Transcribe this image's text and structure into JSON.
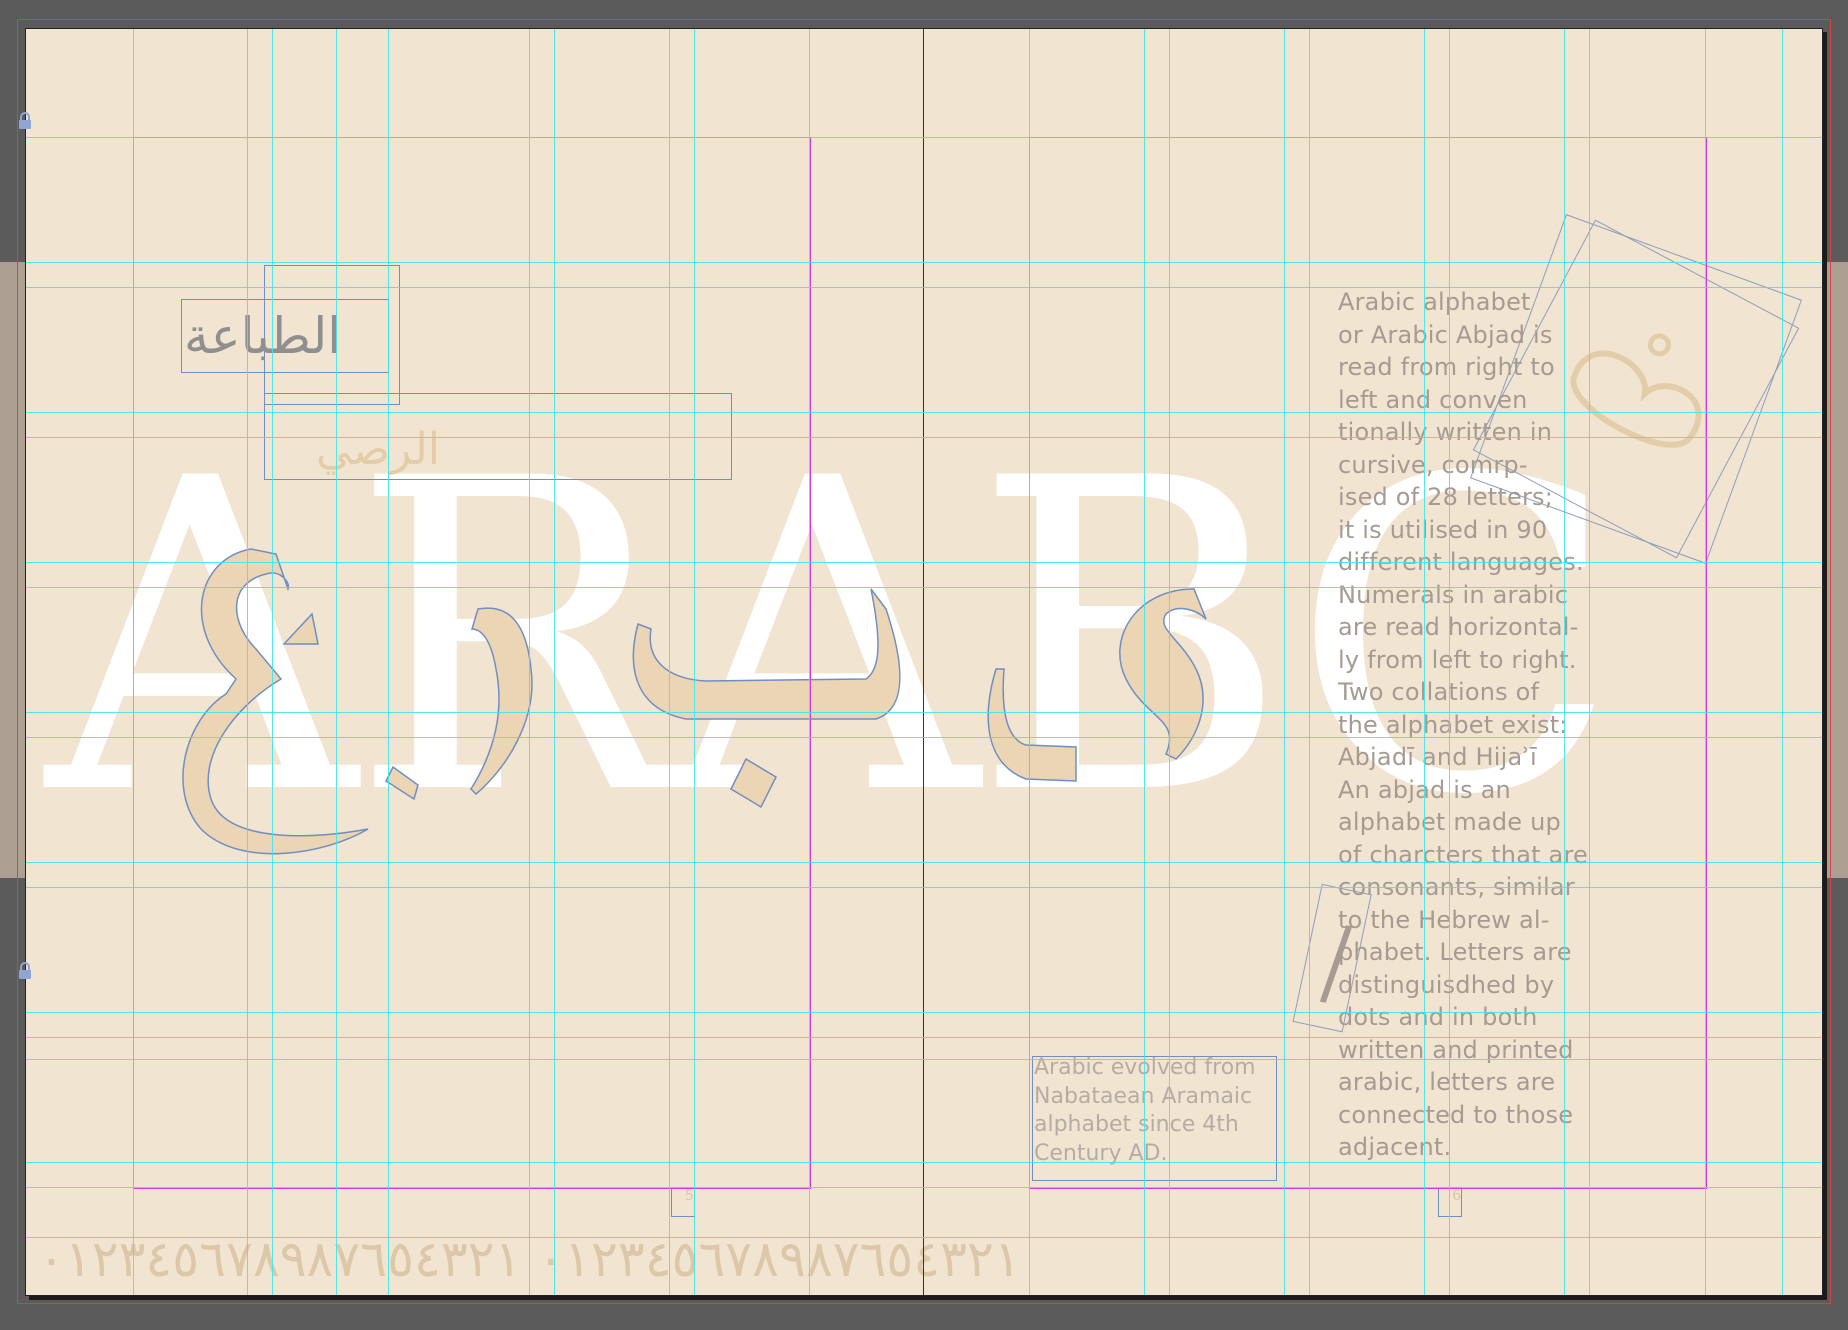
{
  "document": {
    "title_word": "ARABC",
    "arabic_heading": "الطباعة",
    "arabic_subheading": "الرصي",
    "body_text": "Arabic alphabet\nor Arabic Abjad is\nread from right to\nleft and conven\ntionally written in\ncursive, comrp-\nised of 28 letters;\nit is utilised in 90\ndifferent languages.\nNumerals in arabic\nare read horizontal-\nly from left to right.\nTwo collations of\nthe alphabet exist:\nAbjadī and Hijaʾī\nAn abjad is an\nalphabet made up\nof charcters that are\nconsonants, similar\nto the Hebrew al-\nphabet. Letters are\ndistinguisdhed by\ndots and in both\nwritten and printed\narabic, letters are\nconnected to those\nadjacent.",
    "caption_text": "Arabic evolved from\nNabataean Aramaic\nalphabet since 4th\nCentury AD.",
    "numerals_row": "٠١٢٣٤٥٦٧٨٩٨٧٦٥٤٣٢١ ٠١٢٣٤٥٦٧٨٩٨٧٦٥٤٣٢١",
    "page_left": "5",
    "page_right": "6"
  },
  "colors": {
    "page": "#f1e4d0",
    "pasteboard": "#5b5b5b",
    "guide": "#3fe6ea",
    "margin": "#d33bd6",
    "glyph_fill": "#ebd5b5",
    "frame": "#6f8fc1"
  },
  "icons": {
    "lock": "lock-icon"
  }
}
